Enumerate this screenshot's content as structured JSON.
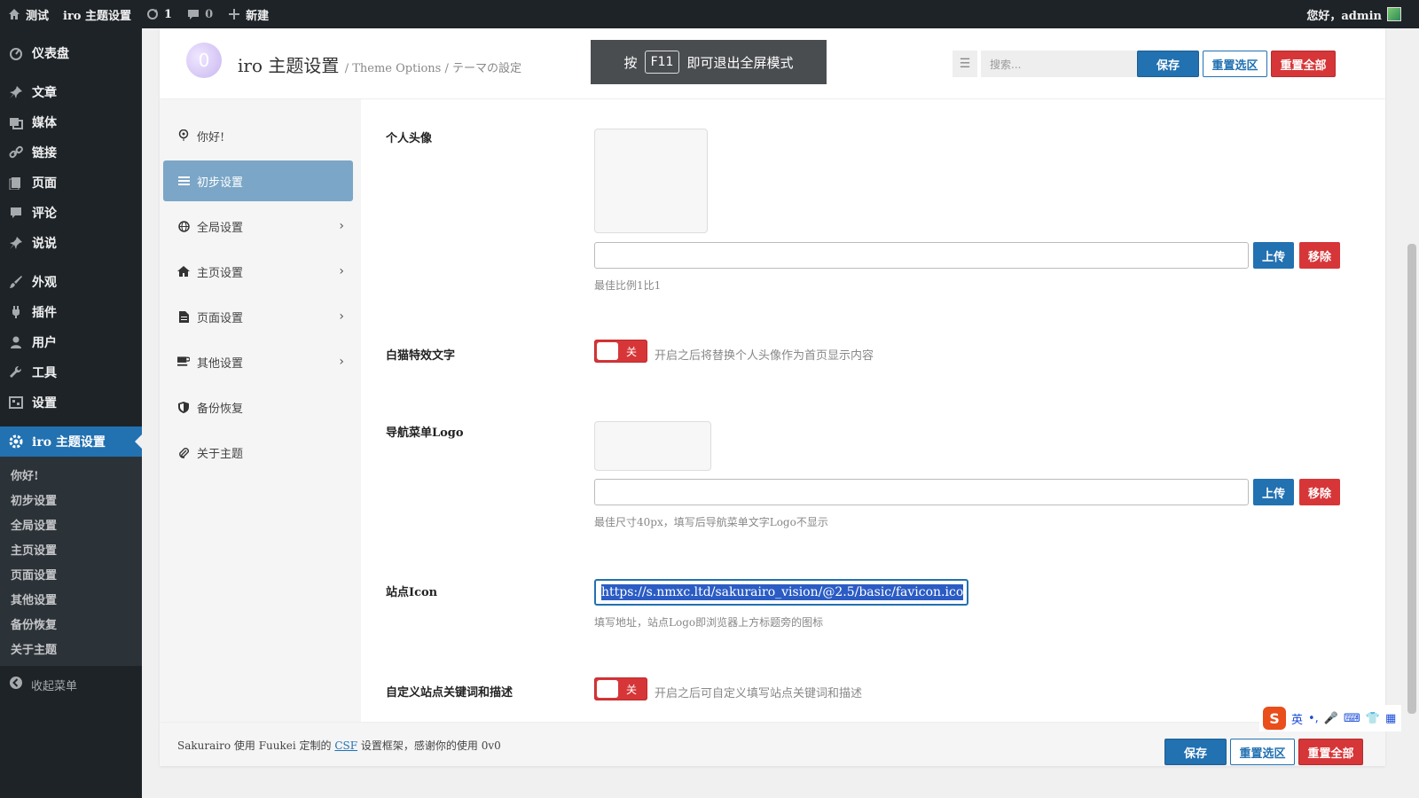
{
  "adminbar": {
    "site_name": "测试",
    "theme_settings": "iro 主题设置",
    "updates_count": "1",
    "comments_count": "0",
    "new_label": "新建",
    "greeting": "您好，admin"
  },
  "sidebar": {
    "items": [
      {
        "label": "仪表盘",
        "icon": "dashboard-icon"
      },
      {
        "label": "文章",
        "icon": "pin-icon"
      },
      {
        "label": "媒体",
        "icon": "media-icon"
      },
      {
        "label": "链接",
        "icon": "link-icon"
      },
      {
        "label": "页面",
        "icon": "page-icon"
      },
      {
        "label": "评论",
        "icon": "comment-icon"
      },
      {
        "label": "说说",
        "icon": "pin-icon"
      },
      {
        "label": "外观",
        "icon": "brush-icon"
      },
      {
        "label": "插件",
        "icon": "plugin-icon"
      },
      {
        "label": "用户",
        "icon": "user-icon"
      },
      {
        "label": "工具",
        "icon": "wrench-icon"
      },
      {
        "label": "设置",
        "icon": "settings-icon"
      }
    ],
    "current": {
      "label": "iro 主题设置",
      "icon": "gear-icon"
    },
    "submenu": [
      "你好!",
      "初步设置",
      "全局设置",
      "主页设置",
      "页面设置",
      "其他设置",
      "备份恢复",
      "关于主题"
    ],
    "collapse_label": "收起菜单"
  },
  "header": {
    "title": "iro 主题设置",
    "subtitle": "/ Theme Options / テーマの設定",
    "f11_pre": "按",
    "f11_key": "F11",
    "f11_post": "即可退出全屏模式",
    "search_placeholder": "搜索...",
    "save": "保存",
    "reset_section": "重置选区",
    "reset_all": "重置全部"
  },
  "optnav": [
    {
      "label": "你好!",
      "icon": "balloon-icon",
      "active": false,
      "chevron": false
    },
    {
      "label": "初步设置",
      "icon": "sliders-icon",
      "active": true,
      "chevron": false
    },
    {
      "label": "全局设置",
      "icon": "globe-icon",
      "active": false,
      "chevron": true
    },
    {
      "label": "主页设置",
      "icon": "home-icon",
      "active": false,
      "chevron": true
    },
    {
      "label": "页面设置",
      "icon": "file-icon",
      "active": false,
      "chevron": true
    },
    {
      "label": "其他设置",
      "icon": "coffee-icon",
      "active": false,
      "chevron": true
    },
    {
      "label": "备份恢复",
      "icon": "shield-icon",
      "active": false,
      "chevron": false
    },
    {
      "label": "关于主题",
      "icon": "paperclip-icon",
      "active": false,
      "chevron": false
    }
  ],
  "fields": {
    "avatar": {
      "label": "个人头像",
      "upload": "上传",
      "remove": "移除",
      "hint": "最佳比例1比1"
    },
    "cat_text": {
      "label": "白猫特效文字",
      "toggle": "关",
      "desc": "开启之后将替换个人头像作为首页显示内容"
    },
    "nav_logo": {
      "label": "导航菜单Logo",
      "upload": "上传",
      "remove": "移除",
      "hint": "最佳尺寸40px，填写后导航菜单文字Logo不显示"
    },
    "site_icon": {
      "label": "站点Icon",
      "value": "https://s.nmxc.ltd/sakurairo_vision/@2.5/basic/favicon.ico",
      "hint": "填写地址，站点Logo即浏览器上方标题旁的图标"
    },
    "custom_keywords": {
      "label": "自定义站点关键词和描述",
      "toggle": "关",
      "desc": "开启之后可自定义填写站点关键词和描述"
    }
  },
  "footer": {
    "text_pre": "Sakurairo 使用 Fuukei 定制的",
    "link": "CSF",
    "text_post": "设置框架，感谢你的使用 0v0",
    "save": "保存",
    "reset_section": "重置选区",
    "reset_all": "重置全部"
  },
  "ime": {
    "lang": "英",
    "punct": "•,"
  },
  "colors": {
    "accent": "#2271b1",
    "danger": "#d63638",
    "active_nav": "#7ba6c7",
    "adminbar": "#1d2327"
  }
}
